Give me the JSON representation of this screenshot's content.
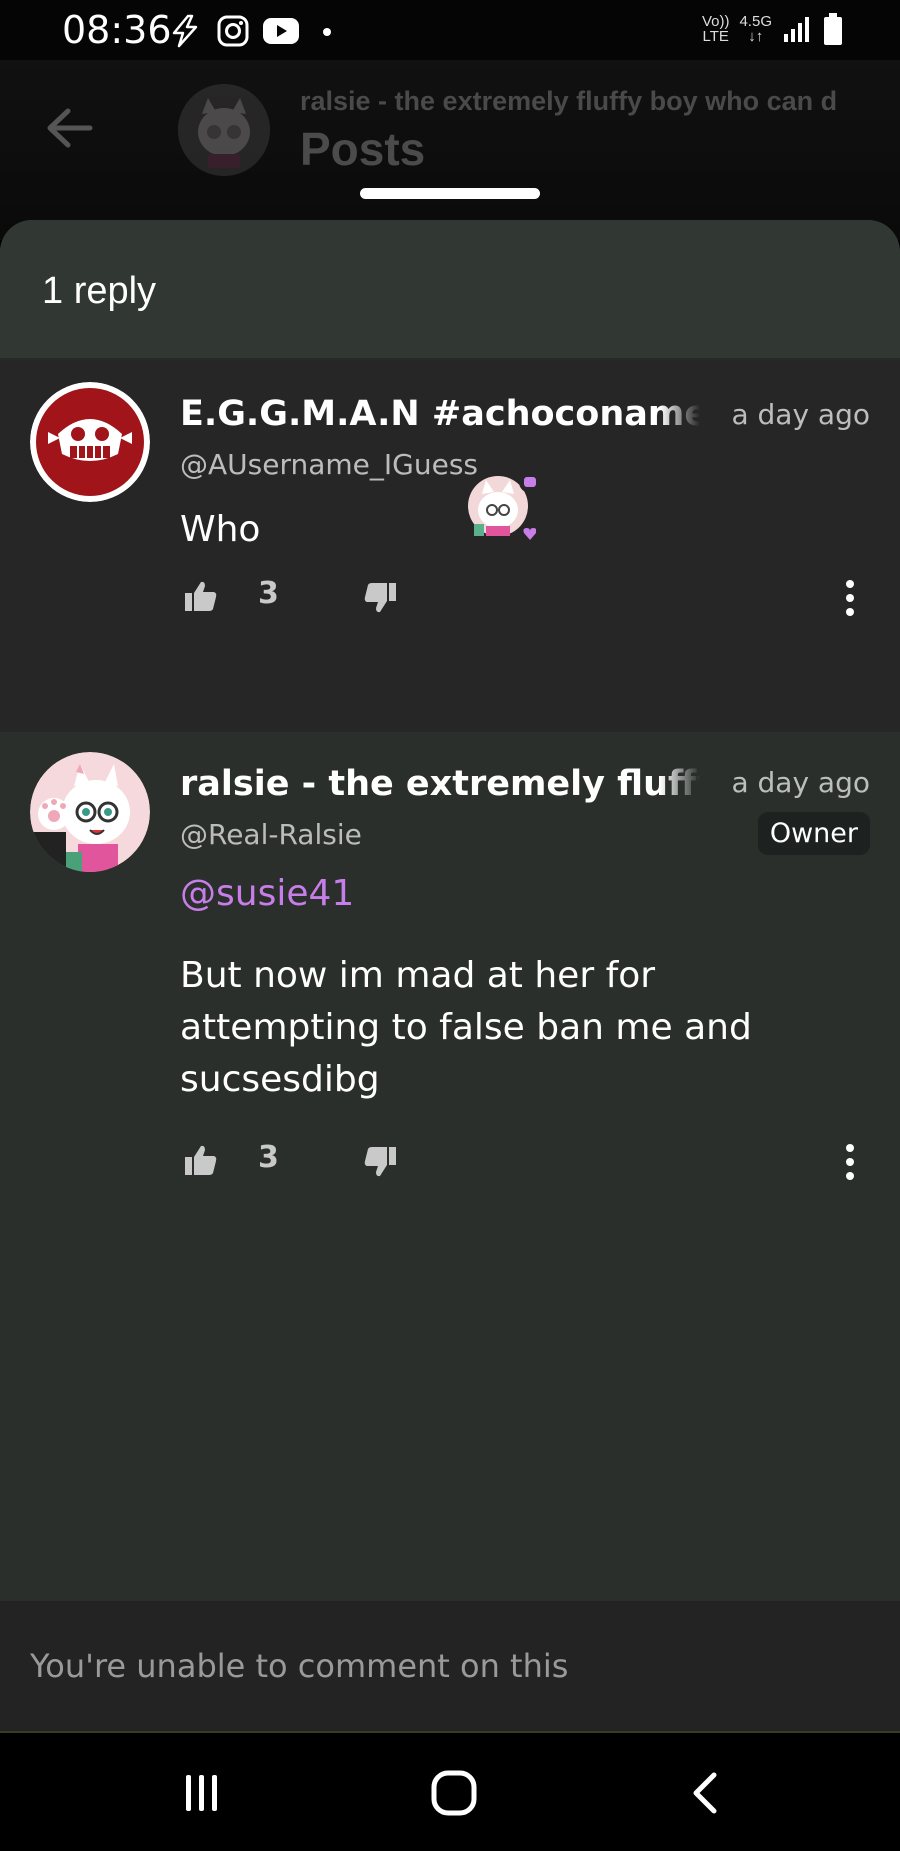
{
  "status_bar": {
    "time": "08:36",
    "network_top": "Vo))",
    "network_bottom": "LTE",
    "speed_top": "4.5G",
    "speed_bottom": "↓↑"
  },
  "header": {
    "subtitle": "ralsie - the extremely fluffy boy who can d",
    "title": "Posts"
  },
  "sheet": {
    "reply_count": "1 reply"
  },
  "comments": [
    {
      "author": "E.G.G.M.A.N #achoconameigu",
      "handle": "@AUsername_IGuess",
      "time": "a day ago",
      "text": "Who",
      "likes": "3"
    },
    {
      "author": "ralsie - the extremely fluffy b",
      "handle": "@Real-Ralsie",
      "time": "a day ago",
      "badge": "Owner",
      "mention": "@susie41",
      "text": "But now im mad at her for attempting to false ban me and sucsesdibg",
      "likes": "3"
    }
  ],
  "footer": {
    "notice": "You're unable to comment on this"
  },
  "colors": {
    "sheet_bg": "#2a2f2c",
    "mention": "#c77ee8",
    "eggman_red": "#a0141a"
  },
  "icons": [
    "lightning-icon",
    "instagram-icon",
    "youtube-icon",
    "back-arrow-icon",
    "thumbs-up-icon",
    "thumbs-down-icon",
    "more-vert-icon",
    "recents-icon",
    "home-icon",
    "nav-back-icon"
  ]
}
